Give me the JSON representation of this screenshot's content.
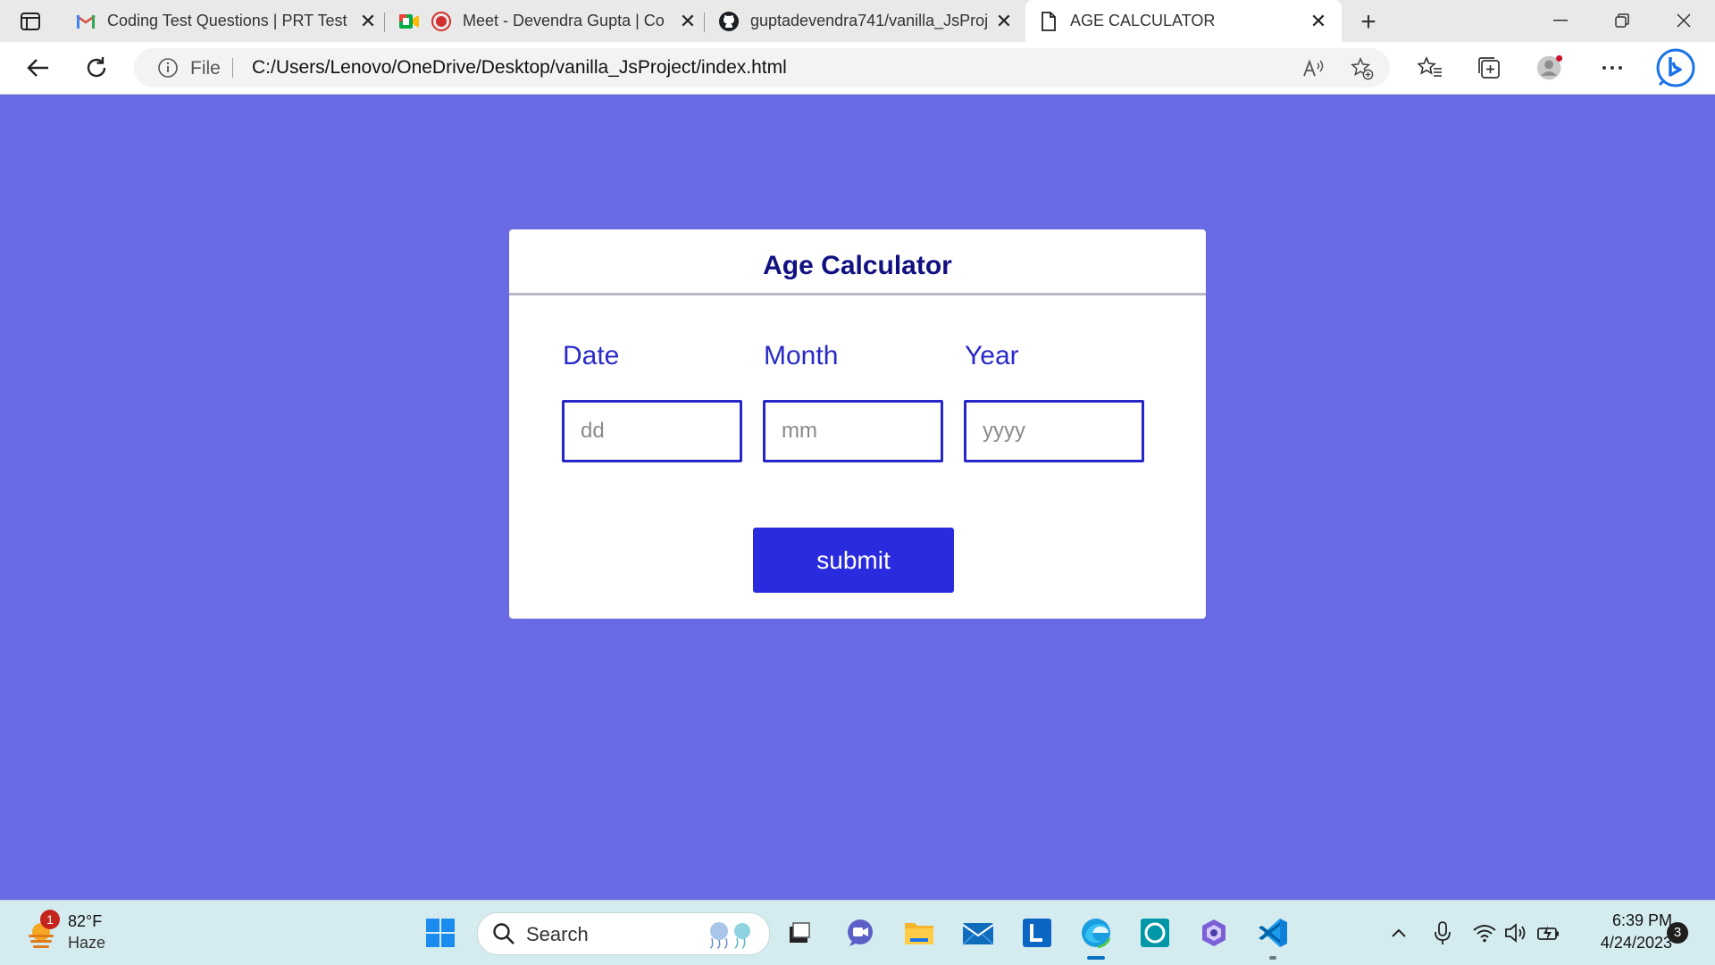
{
  "browser": {
    "tabs": [
      {
        "title": "Coding Test Questions | PRT Test",
        "icon": "gmail-icon"
      },
      {
        "title": "",
        "icon": "google-meet-icon"
      },
      {
        "title": "Meet - Devendra Gupta | Co",
        "icon": "recording-icon"
      },
      {
        "title": "guptadevendra741/vanilla_JsProj",
        "icon": "github-icon"
      },
      {
        "title": "AGE CALCULATOR",
        "icon": "page-icon"
      }
    ],
    "address": {
      "scheme": "File",
      "url": "C:/Users/Lenovo/OneDrive/Desktop/vanilla_JsProject/index.html"
    }
  },
  "page": {
    "background": "#6a6ae4",
    "card": {
      "title": "Age Calculator",
      "fields": [
        {
          "label": "Date",
          "placeholder": "dd",
          "value": ""
        },
        {
          "label": "Month",
          "placeholder": "mm",
          "value": ""
        },
        {
          "label": "Year",
          "placeholder": "yyyy",
          "value": ""
        }
      ],
      "submit_label": "submit"
    },
    "accent": "#2a2ade"
  },
  "taskbar": {
    "weather": {
      "temp": "82°F",
      "condition": "Haze",
      "badge": "1"
    },
    "search_label": "Search",
    "apps": [
      "windows-start-icon",
      "task-view-icon",
      "teams-chat-icon",
      "file-explorer-icon",
      "mail-icon",
      "linkedin-app-icon",
      "edge-icon",
      "alexa-icon",
      "copilot-icon",
      "vscode-icon"
    ],
    "clock": {
      "time": "6:39 PM",
      "date": "4/24/2023"
    },
    "notifications": "3"
  }
}
